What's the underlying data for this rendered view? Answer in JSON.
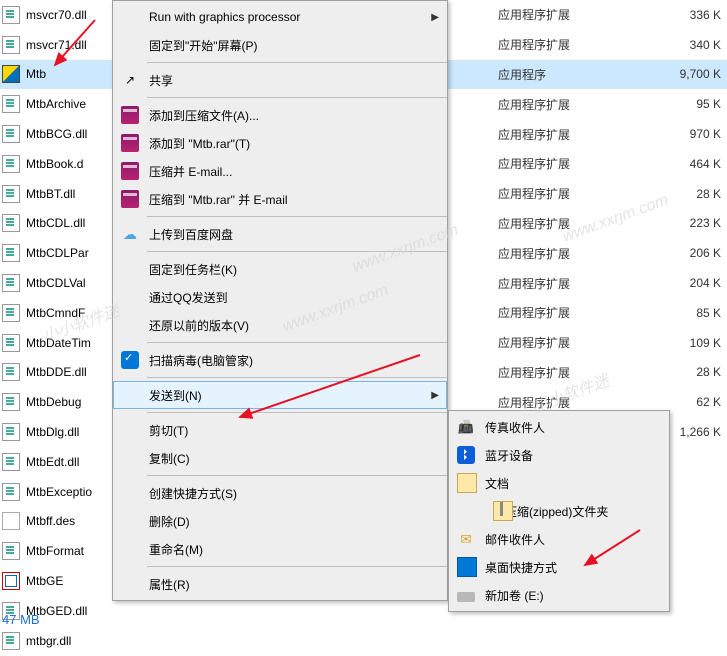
{
  "files": [
    {
      "name": "msvcr70.dll",
      "type": "应用程序扩展",
      "size": "336 K",
      "icon": "dll"
    },
    {
      "name": "msvcr71.dll",
      "type": "应用程序扩展",
      "size": "340 K",
      "icon": "dll"
    },
    {
      "name": "Mtb",
      "type": "应用程序",
      "size": "9,700 K",
      "icon": "exe",
      "selected": true
    },
    {
      "name": "MtbArchive",
      "type": "应用程序扩展",
      "size": "95 K",
      "icon": "dll"
    },
    {
      "name": "MtbBCG.dll",
      "type": "应用程序扩展",
      "size": "970 K",
      "icon": "dll"
    },
    {
      "name": "MtbBook.d",
      "type": "应用程序扩展",
      "size": "464 K",
      "icon": "dll"
    },
    {
      "name": "MtbBT.dll",
      "type": "应用程序扩展",
      "size": "28 K",
      "icon": "dll"
    },
    {
      "name": "MtbCDL.dll",
      "type": "应用程序扩展",
      "size": "223 K",
      "icon": "dll"
    },
    {
      "name": "MtbCDLPar",
      "type": "应用程序扩展",
      "size": "206 K",
      "icon": "dll"
    },
    {
      "name": "MtbCDLVal",
      "type": "应用程序扩展",
      "size": "204 K",
      "icon": "dll"
    },
    {
      "name": "MtbCmndF",
      "type": "应用程序扩展",
      "size": "85 K",
      "icon": "dll"
    },
    {
      "name": "MtbDateTim",
      "type": "应用程序扩展",
      "size": "109 K",
      "icon": "dll"
    },
    {
      "name": "MtbDDE.dll",
      "type": "应用程序扩展",
      "size": "28 K",
      "icon": "dll"
    },
    {
      "name": "MtbDebug",
      "type": "应用程序扩展",
      "size": "62 K",
      "icon": "dll"
    },
    {
      "name": "MtbDlg.dll",
      "type": "应用程序扩展",
      "size": "1,266 K",
      "icon": "dll"
    },
    {
      "name": "MtbEdt.dll",
      "type": "",
      "size": "",
      "icon": "dll"
    },
    {
      "name": "MtbExceptio",
      "type": "",
      "size": "",
      "icon": "dll"
    },
    {
      "name": "Mtbff.des",
      "type": "",
      "size": "",
      "icon": "des"
    },
    {
      "name": "MtbFormat",
      "type": "",
      "size": "",
      "icon": "dll"
    },
    {
      "name": "MtbGE",
      "type": "",
      "size": "",
      "icon": "ge"
    },
    {
      "name": "MtbGED.dll",
      "type": "",
      "size": "",
      "icon": "dll"
    },
    {
      "name": "mtbgr.dll",
      "type": "",
      "size": "",
      "icon": "dll"
    }
  ],
  "status": "47 MB",
  "menu": {
    "truncated_top": "···",
    "graphics": "Run with graphics processor",
    "pin_start": "固定到\"开始\"屏幕(P)",
    "share": "共享",
    "rar_add": "添加到压缩文件(A)...",
    "rar_mtb": "添加到 \"Mtb.rar\"(T)",
    "rar_email": "压缩并 E-mail...",
    "rar_mtb_email": "压缩到 \"Mtb.rar\" 并 E-mail",
    "baidu": "上传到百度网盘",
    "pin_task": "固定到任务栏(K)",
    "qq_send": "通过QQ发送到",
    "restore": "还原以前的版本(V)",
    "scan": "扫描病毒(电脑管家)",
    "send_to": "发送到(N)",
    "cut": "剪切(T)",
    "copy": "复制(C)",
    "shortcut": "创建快捷方式(S)",
    "delete": "删除(D)",
    "rename": "重命名(M)",
    "props": "属性(R)"
  },
  "submenu": {
    "fax": "传真收件人",
    "bluetooth": "蓝牙设备",
    "docs": "文档",
    "zip": "压缩(zipped)文件夹",
    "mail": "邮件收件人",
    "desktop": "桌面快捷方式",
    "drive": "新加卷 (E:)"
  },
  "watermarks": [
    "www.xxrjm.com",
    "小小软件迷",
    "www.xxrjm.com",
    "小小软件迷",
    "www.xxrjm.com"
  ]
}
